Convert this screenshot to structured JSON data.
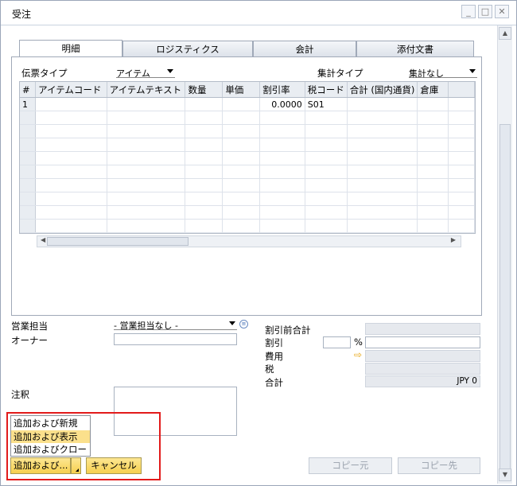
{
  "window": {
    "title": "受注",
    "minimize": "_",
    "maximize": "□",
    "close": "✕"
  },
  "tabs": [
    {
      "label": "明細",
      "active": true
    },
    {
      "label": "ロジスティクス",
      "active": false
    },
    {
      "label": "会計",
      "active": false
    },
    {
      "label": "添付文書",
      "active": false
    }
  ],
  "header": {
    "doc_type_label": "伝票タイプ",
    "doc_type_value": "アイテム",
    "summary_type_label": "集計タイプ",
    "summary_type_value": "集計なし"
  },
  "grid": {
    "columns": [
      "#",
      "アイテムコード",
      "アイテムテキスト",
      "数量",
      "単価",
      "割引率",
      "税コード",
      "合計 (国内通貨)",
      "倉庫"
    ],
    "rows": [
      [
        "1",
        "",
        "",
        "",
        "",
        "0.0000",
        "S01",
        "",
        ""
      ],
      [
        "",
        "",
        "",
        "",
        "",
        "",
        "",
        "",
        ""
      ],
      [
        "",
        "",
        "",
        "",
        "",
        "",
        "",
        "",
        ""
      ],
      [
        "",
        "",
        "",
        "",
        "",
        "",
        "",
        "",
        ""
      ],
      [
        "",
        "",
        "",
        "",
        "",
        "",
        "",
        "",
        ""
      ],
      [
        "",
        "",
        "",
        "",
        "",
        "",
        "",
        "",
        ""
      ],
      [
        "",
        "",
        "",
        "",
        "",
        "",
        "",
        "",
        ""
      ],
      [
        "",
        "",
        "",
        "",
        "",
        "",
        "",
        "",
        ""
      ],
      [
        "",
        "",
        "",
        "",
        "",
        "",
        "",
        "",
        ""
      ],
      [
        "",
        "",
        "",
        "",
        "",
        "",
        "",
        "",
        ""
      ]
    ]
  },
  "footer": {
    "sales_rep_label": "営業担当",
    "sales_rep_value": "- 営業担当なし -",
    "owner_label": "オーナー",
    "owner_value": "",
    "remarks_label": "注釈",
    "remarks_value": ""
  },
  "totals": {
    "subtotal_label": "割引前合計",
    "discount_label": "割引",
    "percent_sign": "%",
    "freight_label": "費用",
    "tax_label": "税",
    "total_label": "合計",
    "total_value": "JPY 0"
  },
  "menu": {
    "items": [
      "追加および新規",
      "追加および表示",
      "追加およびクローズ"
    ],
    "highlighted_index": 1
  },
  "buttons": {
    "primary": "追加および...",
    "cancel": "キャンセル",
    "copy_from": "コピー元",
    "copy_to": "コピー先"
  },
  "colors": {
    "accent": "#f6cf4e",
    "highlight": "#fbe08c",
    "callout": "#e21b1b"
  }
}
